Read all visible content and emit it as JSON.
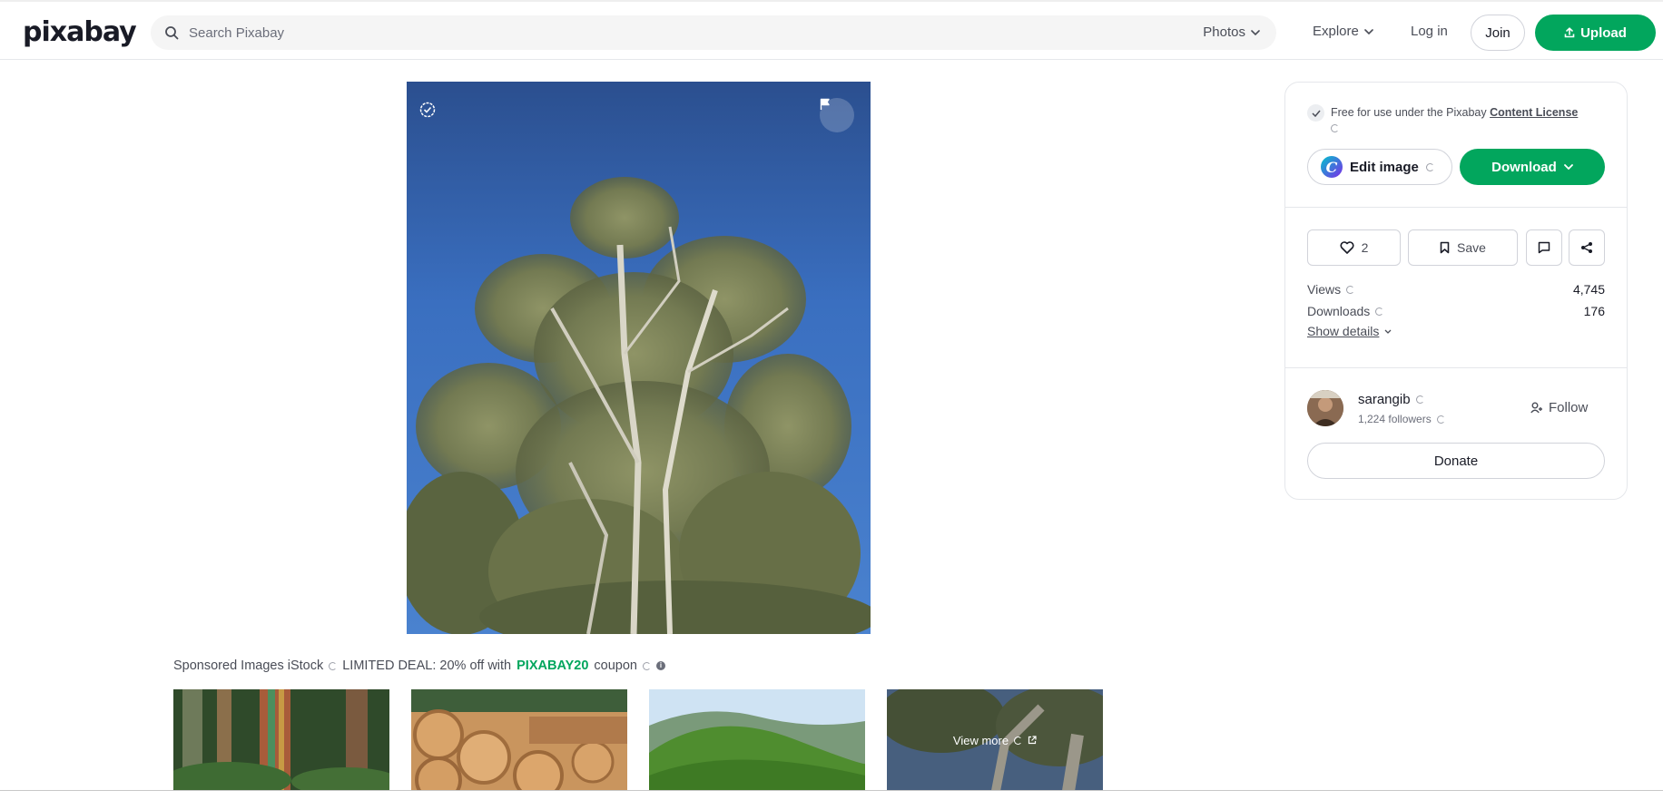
{
  "header": {
    "logo": "pixabay",
    "search_placeholder": "Search Pixabay",
    "search_type": "Photos",
    "explore": "Explore",
    "login": "Log in",
    "join": "Join",
    "upload": "Upload"
  },
  "sponsored": {
    "label": "Sponsored Images iStock",
    "deal": "LIMITED DEAL: 20% off with",
    "code": "PIXABAY20",
    "coupon": "coupon",
    "view_more": "View more"
  },
  "sidebar": {
    "license_text": "Free for use under the Pixabay",
    "license_link": "Content License",
    "edit_image": "Edit image",
    "download": "Download",
    "likes": "2",
    "save": "Save",
    "stats": [
      {
        "label": "Views",
        "value": "4,745"
      },
      {
        "label": "Downloads",
        "value": "176"
      }
    ],
    "show_details": "Show details",
    "user": {
      "name": "sarangib",
      "followers": "1,224 followers",
      "follow": "Follow",
      "donate": "Donate"
    }
  },
  "colors": {
    "accent": "#02a65d",
    "text": "#191b26",
    "muted": "#4a4d57"
  }
}
